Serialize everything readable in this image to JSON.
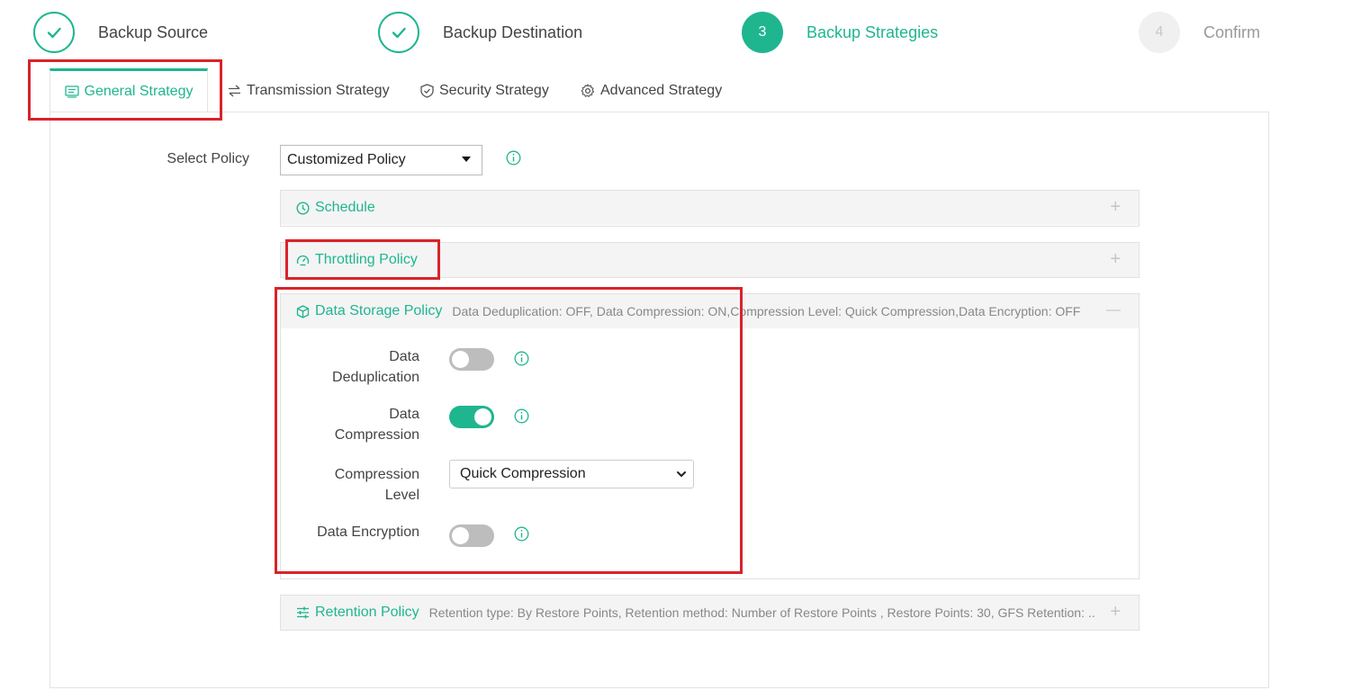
{
  "steps": [
    {
      "label": "Backup Source",
      "state": "done"
    },
    {
      "label": "Backup Destination",
      "state": "done"
    },
    {
      "number": "3",
      "label": "Backup Strategies",
      "state": "active"
    },
    {
      "number": "4",
      "label": "Confirm",
      "state": "pending"
    }
  ],
  "tabs": [
    {
      "label": "General Strategy",
      "icon": "list-icon",
      "active": true
    },
    {
      "label": "Transmission Strategy",
      "icon": "transfer-icon",
      "active": false
    },
    {
      "label": "Security Strategy",
      "icon": "shield-icon",
      "active": false
    },
    {
      "label": "Advanced Strategy",
      "icon": "gear-icon",
      "active": false
    }
  ],
  "policy": {
    "label": "Select Policy",
    "value": "Customized Policy"
  },
  "sections": {
    "schedule": {
      "title": "Schedule",
      "icon": "clock-icon",
      "toggle": "+"
    },
    "throttling": {
      "title": "Throttling Policy",
      "icon": "gauge-icon",
      "toggle": "+"
    },
    "storage": {
      "title": "Data Storage Policy",
      "icon": "cube-icon",
      "summary": "Data Deduplication: OFF, Data Compression: ON,Compression Level: Quick Compression,Data Encryption: OFF",
      "toggle": "—",
      "dedup": {
        "label_line1": "Data",
        "label_line2": "Deduplication",
        "enabled": false
      },
      "compression": {
        "label_line1": "Data",
        "label_line2": "Compression",
        "enabled": true
      },
      "level": {
        "label_line1": "Compression",
        "label_line2": "Level",
        "value": "Quick Compression"
      },
      "encryption": {
        "label": "Data Encryption",
        "enabled": false
      }
    },
    "retention": {
      "title": "Retention Policy",
      "icon": "sliders-icon",
      "summary": "Retention type: By Restore Points, Retention method: Number of Restore Points , Restore Points: 30, GFS Retention: ...",
      "toggle": "+"
    }
  },
  "colors": {
    "accent": "#1fb68f",
    "highlight": "#d9232a"
  }
}
